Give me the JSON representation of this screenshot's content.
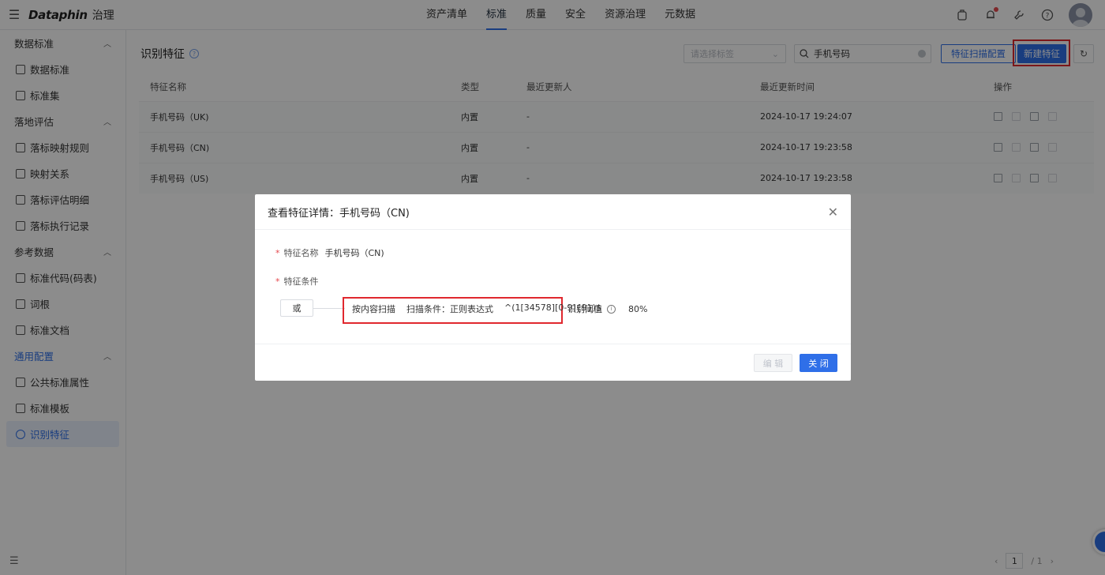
{
  "header": {
    "brand": "Dataphin",
    "module": "治理",
    "nav": [
      "资产清单",
      "标准",
      "质量",
      "安全",
      "资源治理",
      "元数据"
    ],
    "active_nav": "标准"
  },
  "sidebar": {
    "groups": [
      {
        "label": "数据标准",
        "items": [
          "数据标准",
          "标准集"
        ]
      },
      {
        "label": "落地评估",
        "items": [
          "落标映射规则",
          "映射关系",
          "落标评估明细",
          "落标执行记录"
        ]
      },
      {
        "label": "参考数据",
        "items": [
          "标准代码(码表)",
          "词根",
          "标准文档"
        ]
      },
      {
        "label": "通用配置",
        "items": [
          "公共标准属性",
          "标准模板",
          "识别特征"
        ]
      }
    ],
    "active_item": "识别特征"
  },
  "page": {
    "title": "识别特征",
    "select_placeholder": "请选择标签",
    "search_value": "手机号码",
    "scan_config_button": "特征扫描配置",
    "new_button": "新建特征"
  },
  "table": {
    "columns": [
      "特征名称",
      "类型",
      "最近更新人",
      "最近更新时间",
      "操作"
    ],
    "rows": [
      {
        "name": "手机号码（UK)",
        "type": "内置",
        "updater": "-",
        "time": "2024-10-17 19:24:07"
      },
      {
        "name": "手机号码（CN)",
        "type": "内置",
        "updater": "-",
        "time": "2024-10-17 19:23:58"
      },
      {
        "name": "手机号码（US)",
        "type": "内置",
        "updater": "-",
        "time": "2024-10-17 19:23:58"
      }
    ]
  },
  "pagination": {
    "current": "1",
    "total": "/ 1"
  },
  "modal": {
    "title": "查看特征详情：手机号码（CN)",
    "name_label": "特征名称",
    "name_value": "手机号码（CN)",
    "condition_label": "特征条件",
    "logic": "或",
    "scan_type": "按内容扫描",
    "scan_condition": "扫描条件：正则表达式",
    "regex": "^(1[34578][0-9]{9})$",
    "threshold_label": "识别阈值",
    "threshold_value": "80%",
    "edit_button": "编 辑",
    "close_button": "关 闭"
  }
}
